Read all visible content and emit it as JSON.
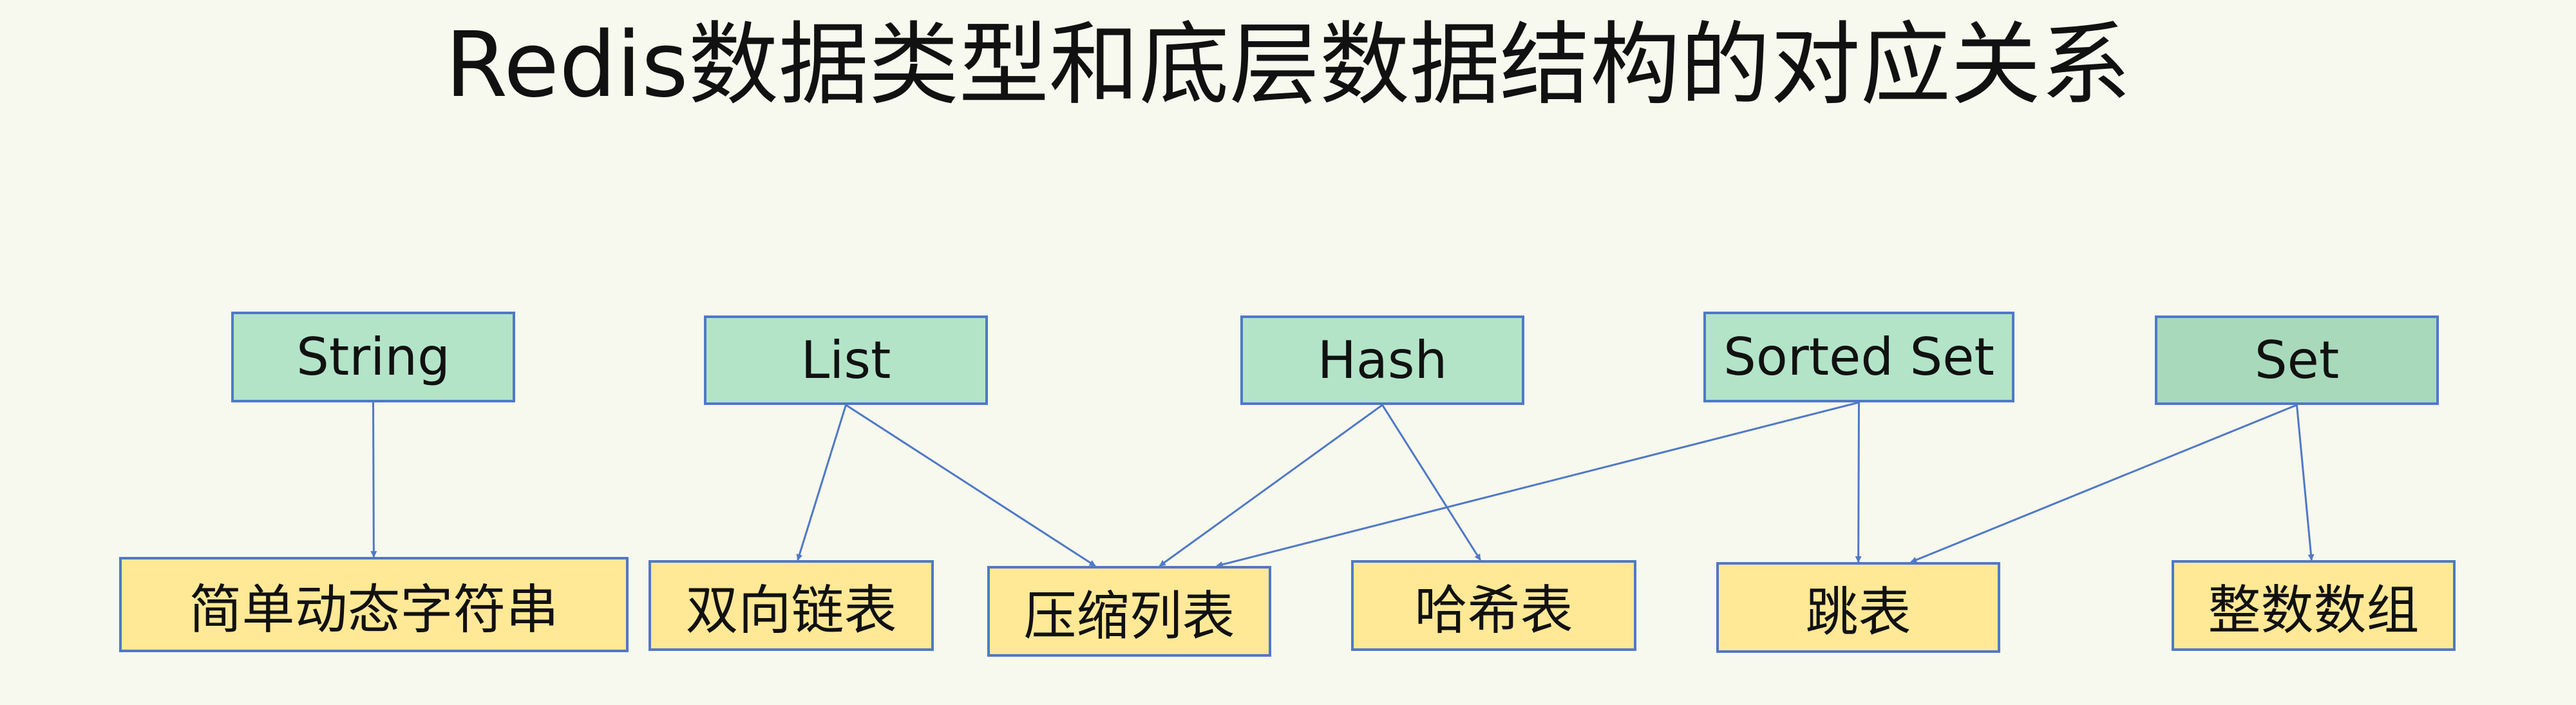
{
  "title": "Redis数据类型和底层数据结构的对应关系",
  "colors": {
    "background": "#f7f8ee",
    "type_fill": "#b3e4c8",
    "type_fill_alt": "#a8d9bb",
    "structure_fill": "#ffe896",
    "border": "#4f79c6",
    "arrow": "#4f79c6"
  },
  "data_types": [
    {
      "id": "string",
      "label": "String"
    },
    {
      "id": "list",
      "label": "List"
    },
    {
      "id": "hash",
      "label": "Hash"
    },
    {
      "id": "sorted_set",
      "label": "Sorted Set"
    },
    {
      "id": "set",
      "label": "Set"
    }
  ],
  "structures": [
    {
      "id": "sds",
      "label": "简单动态字符串"
    },
    {
      "id": "linkedlist",
      "label": "双向链表"
    },
    {
      "id": "ziplist",
      "label": "压缩列表"
    },
    {
      "id": "hashtable",
      "label": "哈希表"
    },
    {
      "id": "skiplist",
      "label": "跳表"
    },
    {
      "id": "intset",
      "label": "整数数组"
    }
  ],
  "edges": [
    {
      "from": "string",
      "to": "sds"
    },
    {
      "from": "list",
      "to": "linkedlist"
    },
    {
      "from": "list",
      "to": "ziplist"
    },
    {
      "from": "hash",
      "to": "ziplist"
    },
    {
      "from": "hash",
      "to": "hashtable"
    },
    {
      "from": "sorted_set",
      "to": "ziplist"
    },
    {
      "from": "sorted_set",
      "to": "skiplist"
    },
    {
      "from": "set",
      "to": "skiplist"
    },
    {
      "from": "set",
      "to": "intset"
    }
  ]
}
